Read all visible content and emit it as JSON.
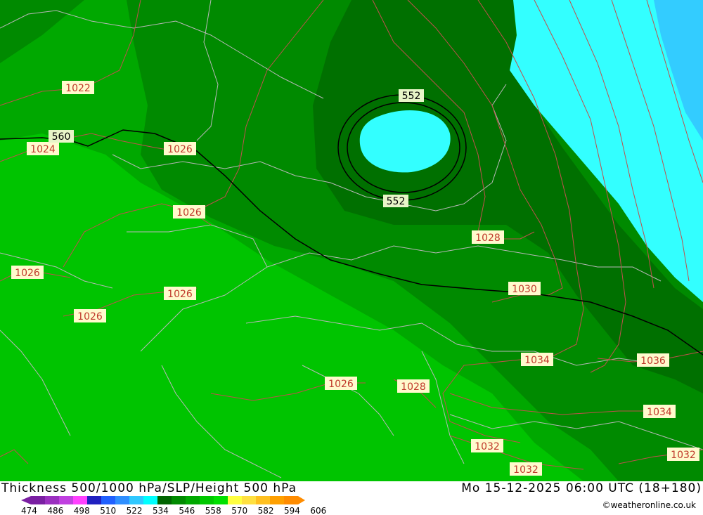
{
  "header": {
    "title": "Thickness 500/1000 hPa/SLP/Height 500 hPa",
    "datetime": "Mo 15-12-2025 06:00 UTC (18+180)",
    "credit": "©weatheronline.co.uk"
  },
  "legend": {
    "ticks": [
      "474",
      "486",
      "498",
      "510",
      "522",
      "534",
      "546",
      "558",
      "570",
      "582",
      "594",
      "606"
    ],
    "colors": [
      "#7a1fa2",
      "#9b30c0",
      "#c040e0",
      "#ff40ff",
      "#2020c0",
      "#2060ff",
      "#2f8fff",
      "#30c8ff",
      "#00ffff",
      "#006400",
      "#008a00",
      "#00a800",
      "#00c800",
      "#00e000",
      "#ffff40",
      "#ffe040",
      "#ffc020",
      "#ffa000",
      "#ff8c00"
    ]
  },
  "map": {
    "colors": {
      "green_light": "#00c400",
      "green_mid": "#00a800",
      "green_dark": "#008a00",
      "green_darkest": "#007000",
      "cyan": "#33ffff",
      "blue": "#33ccff",
      "isobar": "#c0504d",
      "border": "#b0b0b0"
    },
    "slp_labels": [
      "1022",
      "1024",
      "1026",
      "1026",
      "1026",
      "1026",
      "1026",
      "1026",
      "1028",
      "1028",
      "1030",
      "1034",
      "1036",
      "1034",
      "1032",
      "1032",
      "1032"
    ],
    "thickness_labels": [
      "560",
      "552",
      "552"
    ]
  }
}
